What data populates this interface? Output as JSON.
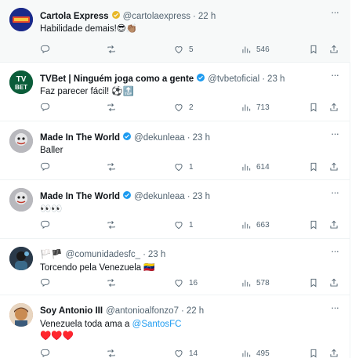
{
  "tweets": [
    {
      "name": "Cartola Express",
      "handle": "@cartolaexpress",
      "time": "22 h",
      "text": "Habilidade demais!😎👏🏽",
      "verified": "gold",
      "stats": {
        "replies": "",
        "retweets": "",
        "likes": "5",
        "views": "546"
      },
      "avatar_color": "#1b2a8a"
    },
    {
      "name": "TVBet | Ninguém joga como a gente",
      "handle": "@tvbetoficial",
      "time": "23 h",
      "text": "Faz parecer fácil! ⚽🔝",
      "verified": "blue",
      "stats": {
        "replies": "",
        "retweets": "",
        "likes": "2",
        "views": "713"
      },
      "avatar_color": "#0b5d3a"
    },
    {
      "name": "Made In The World",
      "handle": "@dekunleaa",
      "time": "23 h",
      "text": "Baller",
      "verified": "blue",
      "stats": {
        "replies": "",
        "retweets": "",
        "likes": "1",
        "views": "614"
      },
      "avatar_color": "#9a9aa0"
    },
    {
      "name": "Made In The World",
      "handle": "@dekunleaa",
      "time": "23 h",
      "text": "👀👀",
      "verified": "blue",
      "stats": {
        "replies": "",
        "retweets": "",
        "likes": "1",
        "views": "663"
      },
      "avatar_color": "#9a9aa0"
    },
    {
      "name": "🏳️🏴",
      "handle": "@comunidadesfc_",
      "time": "23 h",
      "text": "Torcendo pela Venezuela 🇻🇪",
      "verified": "",
      "stats": {
        "replies": "",
        "retweets": "",
        "likes": "16",
        "views": "578"
      },
      "avatar_color": "#2a3a4a"
    },
    {
      "name": "Soy Antonio III",
      "handle": "@antonioalfonzo7",
      "time": "22 h",
      "text": "Venezuela toda ama a",
      "mention": "@SantosFC",
      "text2": "♥️♥️♥️",
      "verified": "",
      "stats": {
        "replies": "",
        "retweets": "",
        "likes": "14",
        "views": "495"
      },
      "avatar_color": "#c98b52"
    }
  ],
  "colors": {
    "accent": "#1d9bf0",
    "muted": "#536471",
    "gold": "#e8b829"
  },
  "icons": [
    "reply-icon",
    "retweet-icon",
    "like-icon",
    "views-icon",
    "bookmark-icon",
    "share-icon",
    "more-icon",
    "verified-badge-icon"
  ]
}
